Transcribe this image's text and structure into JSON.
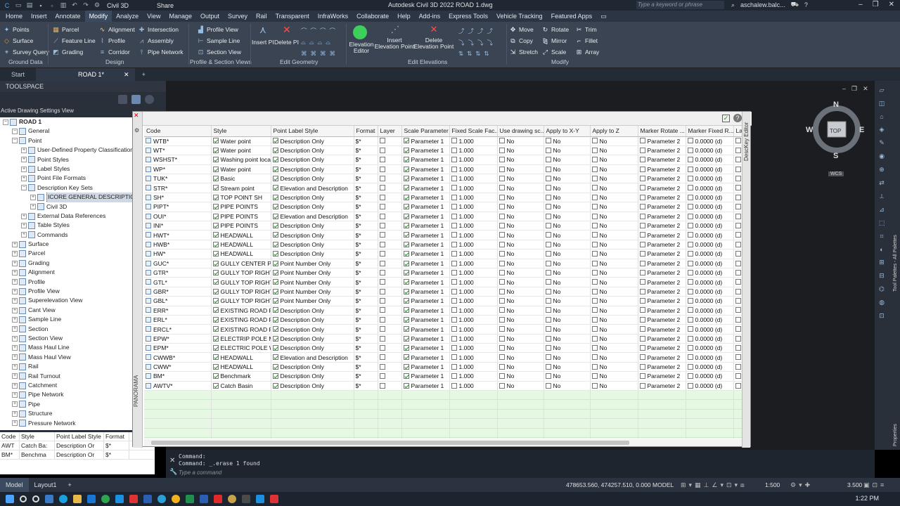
{
  "titlebar": {
    "app": "Civil 3D",
    "share": "Share",
    "doc_title": "Autodesk Civil 3D 2022    ROAD 1.dwg",
    "search_placeholder": "Type a keyword or phrase",
    "user": "aschalew.balc..."
  },
  "menu_tabs": [
    "Home",
    "Insert",
    "Annotate",
    "Modify",
    "Analyze",
    "View",
    "Manage",
    "Output",
    "Survey",
    "Rail",
    "Transparent",
    "InfraWorks",
    "Collaborate",
    "Help",
    "Add-ins",
    "Express Tools",
    "Vehicle Tracking",
    "Featured Apps"
  ],
  "ribbon": {
    "ground_data": {
      "items": [
        "Points",
        "Surface",
        "Survey Query"
      ],
      "title": "Ground Data"
    },
    "design": {
      "items": [
        "Parcel",
        "Feature Line",
        "Grading",
        "Alignment",
        "Profile",
        "Corridor",
        "Intersection",
        "Assembly",
        "Pipe Network"
      ],
      "title": "Design"
    },
    "profile_section": {
      "items": [
        "Profile View",
        "Sample Line",
        "Section View"
      ],
      "title": "Profile & Section Views"
    },
    "edit_geometry": {
      "items": [
        "Insert PI",
        "Delete PI"
      ],
      "title": "Edit Geometry"
    },
    "edit_elevations": {
      "items": [
        "Elevation Editor",
        "Insert Elevation Point",
        "Delete Elevation Point"
      ],
      "title": "Edit Elevations"
    },
    "modify": {
      "items": [
        "Move",
        "Rotate",
        "Trim",
        "Copy",
        "Mirror",
        "Fillet",
        "Stretch",
        "Scale",
        "Array"
      ],
      "title": "Modify"
    }
  },
  "doc_tabs": [
    "Start",
    "ROAD 1*"
  ],
  "toolspace": {
    "title": "TOOLSPACE",
    "view": "Active Drawing Settings View",
    "tree": [
      {
        "label": "ROAD 1",
        "level": 0,
        "bold": true
      },
      {
        "label": "General",
        "level": 1
      },
      {
        "label": "Point",
        "level": 1
      },
      {
        "label": "User-Defined Property Classifications",
        "level": 2
      },
      {
        "label": "Point Styles",
        "level": 2
      },
      {
        "label": "Label Styles",
        "level": 2
      },
      {
        "label": "Point File Formats",
        "level": 2
      },
      {
        "label": "Description Key Sets",
        "level": 2
      },
      {
        "label": "ICORE GENERAL DESCRIPTION KE",
        "level": 3,
        "selected": true
      },
      {
        "label": "Civil 3D",
        "level": 3
      },
      {
        "label": "External Data References",
        "level": 2
      },
      {
        "label": "Table Styles",
        "level": 2
      },
      {
        "label": "Commands",
        "level": 2
      },
      {
        "label": "Surface",
        "level": 1
      },
      {
        "label": "Parcel",
        "level": 1
      },
      {
        "label": "Grading",
        "level": 1
      },
      {
        "label": "Alignment",
        "level": 1
      },
      {
        "label": "Profile",
        "level": 1
      },
      {
        "label": "Profile View",
        "level": 1
      },
      {
        "label": "Superelevation View",
        "level": 1
      },
      {
        "label": "Cant View",
        "level": 1
      },
      {
        "label": "Sample Line",
        "level": 1
      },
      {
        "label": "Section",
        "level": 1
      },
      {
        "label": "Section View",
        "level": 1
      },
      {
        "label": "Mass Haul Line",
        "level": 1
      },
      {
        "label": "Mass Haul View",
        "level": 1
      },
      {
        "label": "Rail",
        "level": 1
      },
      {
        "label": "Rail Turnout",
        "level": 1
      },
      {
        "label": "Catchment",
        "level": 1
      },
      {
        "label": "Pipe Network",
        "level": 1
      },
      {
        "label": "Pipe",
        "level": 1
      },
      {
        "label": "Structure",
        "level": 1
      },
      {
        "label": "Pressure Network",
        "level": 1
      }
    ],
    "mini_grid": {
      "headers": [
        "Code",
        "Style",
        "Point Label Style",
        "Format"
      ],
      "rows": [
        [
          "AWT",
          "Catch Ba:",
          "Description Or",
          "$*"
        ],
        [
          "BM*",
          "Benchma",
          "Description Or",
          "$*"
        ]
      ]
    }
  },
  "editor": {
    "panorama": "PANORAMA",
    "side_label": "DescKey Editor",
    "headers": [
      "Code",
      "Style",
      "Point Label Style",
      "Format",
      "Layer",
      "Scale Parameter",
      "Fixed Scale Fac...",
      "Use drawing sc...",
      "Apply to X-Y",
      "Apply to Z",
      "Marker Rotate ...",
      "Marker Fixed R...",
      "La"
    ],
    "rows": [
      [
        "WTB*",
        "Water point",
        "Description Only"
      ],
      [
        "WT*",
        "Water point",
        "Description Only"
      ],
      [
        "WSHST*",
        "Washing point local",
        "Description Only"
      ],
      [
        "WP*",
        "Water point",
        "Description Only"
      ],
      [
        "TUK*",
        "Basic",
        "Description Only"
      ],
      [
        "STR*",
        "Stream point",
        "Elevation and Description"
      ],
      [
        "SH*",
        "TOP POINT SH",
        "Description Only"
      ],
      [
        "PIPT*",
        "PIPE POINTS",
        "Description Only"
      ],
      [
        "OUI*",
        "PIPE POINTS",
        "Elevation and Description"
      ],
      [
        "INI*",
        "PIPE POINTS",
        "Description Only"
      ],
      [
        "HWT*",
        "HEADWALL",
        "Description Only"
      ],
      [
        "HWB*",
        "HEADWALL",
        "Description Only"
      ],
      [
        "HW*",
        "HEADWALL",
        "Description Only"
      ],
      [
        "GUC*",
        "GULLY CENTER POIN",
        "Point Number Only"
      ],
      [
        "GTR*",
        "GULLY TOP RIGHT",
        "Point Number Only"
      ],
      [
        "GTL*",
        "GULLY TOP RIGHT",
        "Point Number Only"
      ],
      [
        "GBR*",
        "GULLY TOP RIGHT",
        "Point Number Only"
      ],
      [
        "GBL*",
        "GULLY TOP RIGHT",
        "Point Number Only"
      ],
      [
        "ERR*",
        "EXISTING ROAD RIGH",
        "Description Only"
      ],
      [
        "ERL*",
        "EXISTING ROAD RIGH",
        "Description Only"
      ],
      [
        "ERCL*",
        "EXISTING ROAD RIGH",
        "Description Only"
      ],
      [
        "EPW*",
        "ELECTRIP POLE META",
        "Description Only"
      ],
      [
        "EPM*",
        "ELECTRIC POLE WOC",
        "Description Only"
      ],
      [
        "CWWB*",
        "HEADWALL",
        "Elevation and Description"
      ],
      [
        "CWW*",
        "HEADWALL",
        "Description Only"
      ],
      [
        "BM*",
        "Benchmark",
        "Description Only"
      ],
      [
        "AWTV*",
        "Catch Basin",
        "Description Only"
      ]
    ],
    "common": {
      "format": "$*",
      "scale": "Parameter 1",
      "fixed_scale": "1.000",
      "use_drawing": "No",
      "apply_xy": "No",
      "apply_z": "No",
      "marker_rotate": "Parameter 2",
      "marker_fixed": "0.0000 (d)"
    }
  },
  "navcube": {
    "n": "N",
    "s": "S",
    "e": "E",
    "w": "W",
    "top": "TOP",
    "wcs": "WCS"
  },
  "command": {
    "line1": "Command:",
    "line2": "Command: _.erase 1 found",
    "placeholder": "Type a command"
  },
  "status": {
    "tabs": [
      "Model",
      "Layout1"
    ],
    "coords": "478653.560, 474257.510, 0.000",
    "model": "MODEL",
    "scale": "1:500",
    "zoom": "3.500",
    "time": "1:22 PM"
  },
  "right_palette": {
    "tool_palettes": "Tool Palettes - All Palettes",
    "properties": "Properties"
  }
}
